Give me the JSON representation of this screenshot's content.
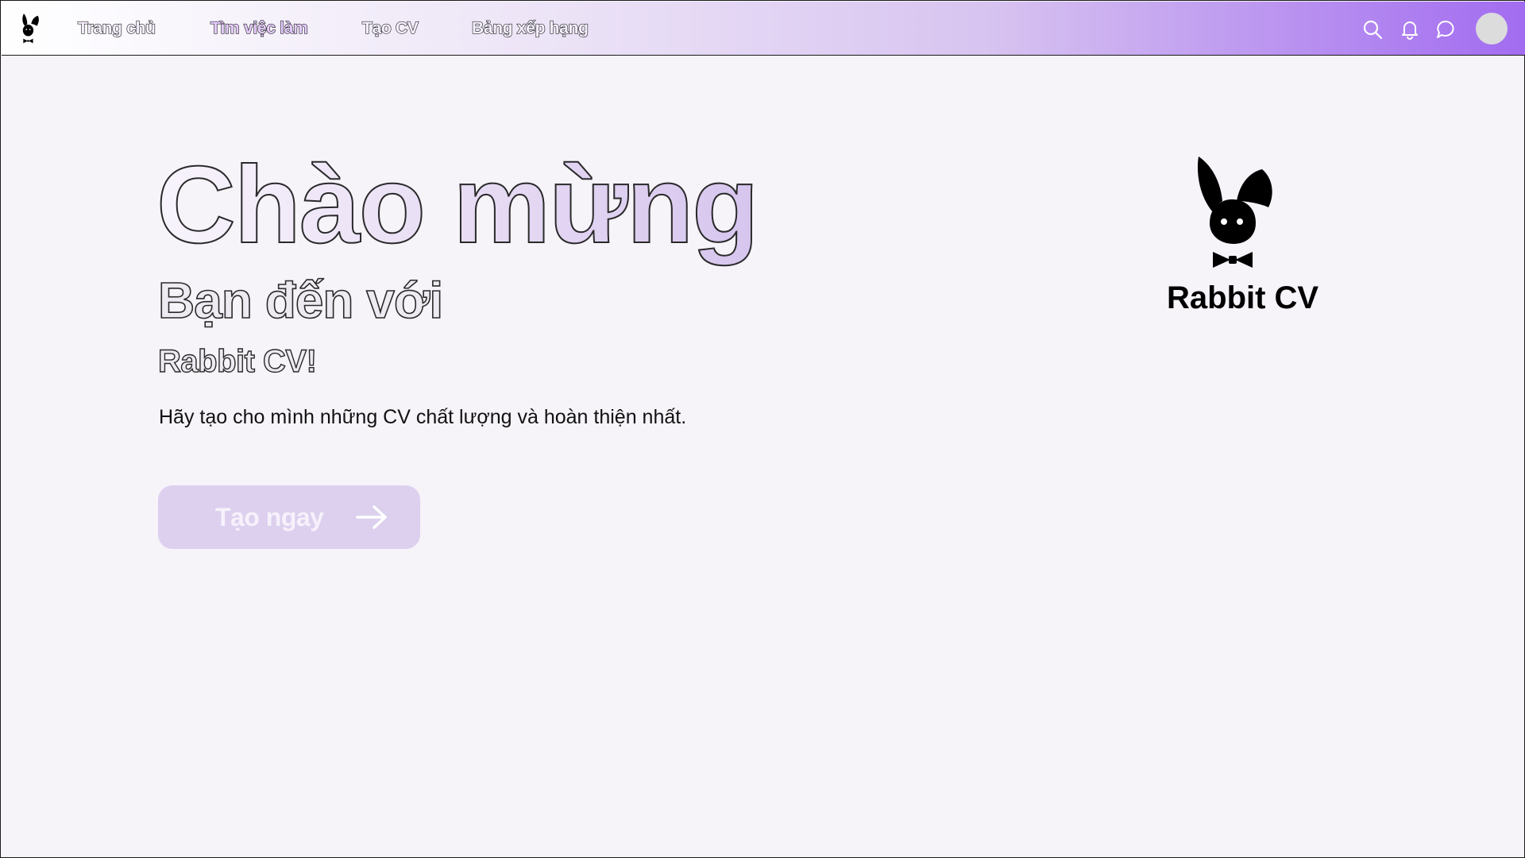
{
  "nav": {
    "items": [
      {
        "label": "Trang chủ",
        "active": false
      },
      {
        "label": "Tìm việc làm",
        "active": true
      },
      {
        "label": "Tạo CV",
        "active": false
      },
      {
        "label": "Bảng xếp hạng",
        "active": false
      }
    ],
    "icons": [
      "search-icon",
      "bell-icon",
      "chat-icon"
    ],
    "accent_color": "#a26cf0"
  },
  "hero": {
    "title": "Chào mừng",
    "subtitle": "Bạn đến với",
    "brand": "Rabbit CV!",
    "description": "Hãy tạo cho mình những CV chất lượng và hoàn thiện nhất.",
    "cta_label": "Tạo ngay",
    "cta_color": "#ddd0ee"
  },
  "brand_logo": {
    "name": "Rabbit CV",
    "icon": "rabbit-logo-icon"
  }
}
